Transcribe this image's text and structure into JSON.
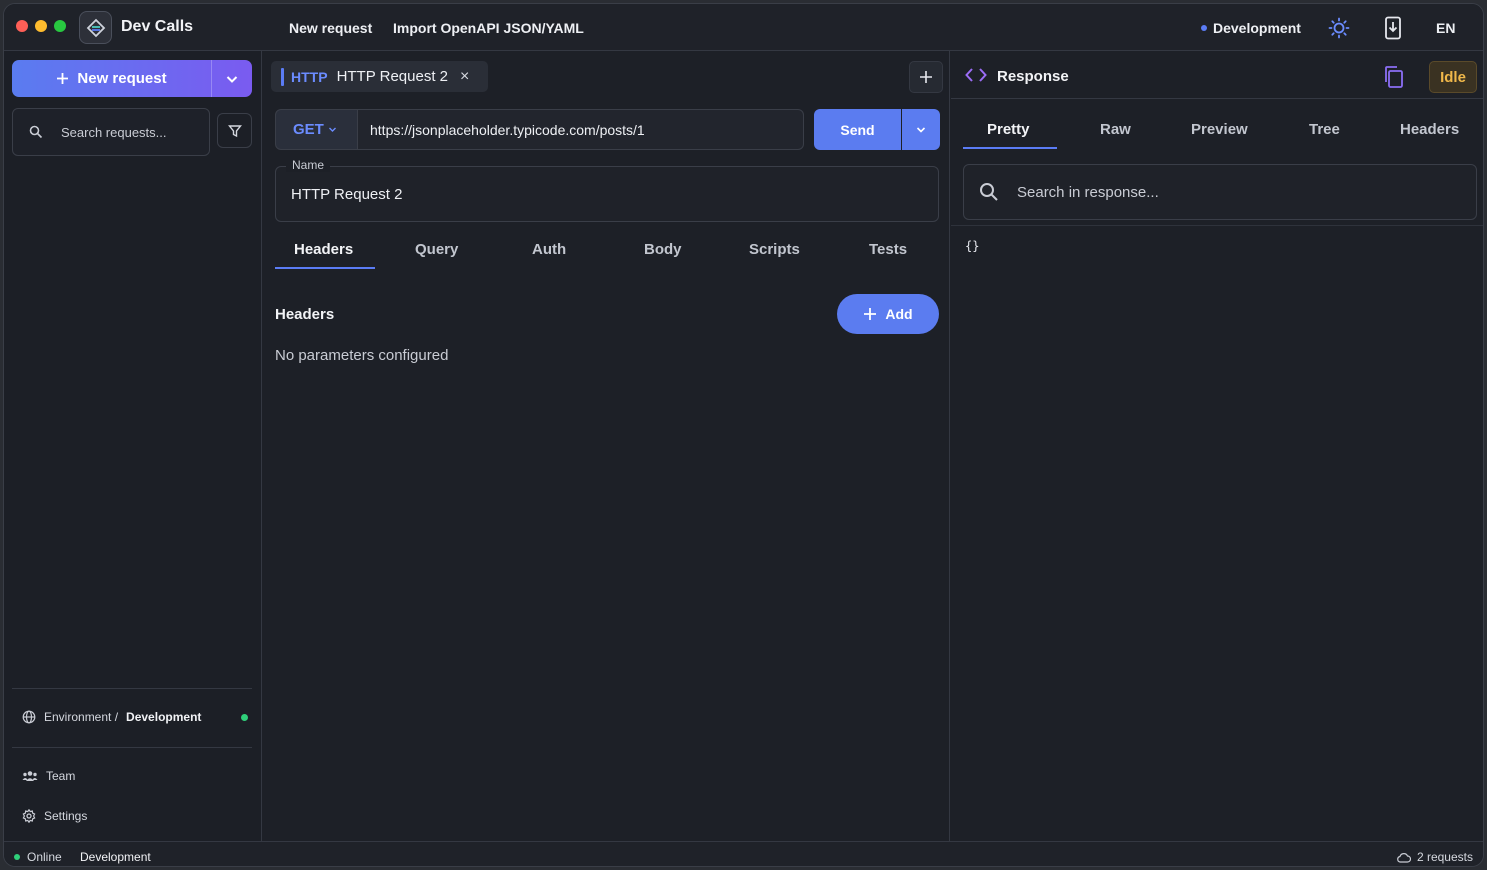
{
  "app": {
    "title": "Dev Calls"
  },
  "menu": {
    "new_request": "New request",
    "import": "Import OpenAPI JSON/YAML"
  },
  "titlebar": {
    "environment": "Development",
    "language": "EN"
  },
  "sidebar": {
    "new_request_label": "New request",
    "search_placeholder": "Search requests...",
    "environment_prefix": "Environment /",
    "environment_name": "Development",
    "team_label": "Team",
    "settings_label": "Settings"
  },
  "request_tab": {
    "type": "HTTP",
    "name": "HTTP Request 2",
    "close": "×"
  },
  "request": {
    "method": "GET",
    "url": "https://jsonplaceholder.typicode.com/posts/1",
    "send_label": "Send",
    "name_label": "Name",
    "name_value": "HTTP Request 2"
  },
  "request_tabs": [
    "Headers",
    "Query",
    "Auth",
    "Body",
    "Scripts",
    "Tests"
  ],
  "headers_section": {
    "title": "Headers",
    "add_label": "Add",
    "empty_message": "No parameters configured"
  },
  "response": {
    "title": "Response",
    "status": "Idle",
    "tabs": [
      "Pretty",
      "Raw",
      "Preview",
      "Tree",
      "Headers"
    ],
    "search_placeholder": "Search in response...",
    "body": "{}"
  },
  "statusbar": {
    "online": "Online",
    "environment": "Development",
    "requests": "2 requests"
  },
  "colors": {
    "accent": "#5b7cf0",
    "method_get": "#6b8cff",
    "idle": "#f0b84a",
    "online": "#2fd07a"
  }
}
